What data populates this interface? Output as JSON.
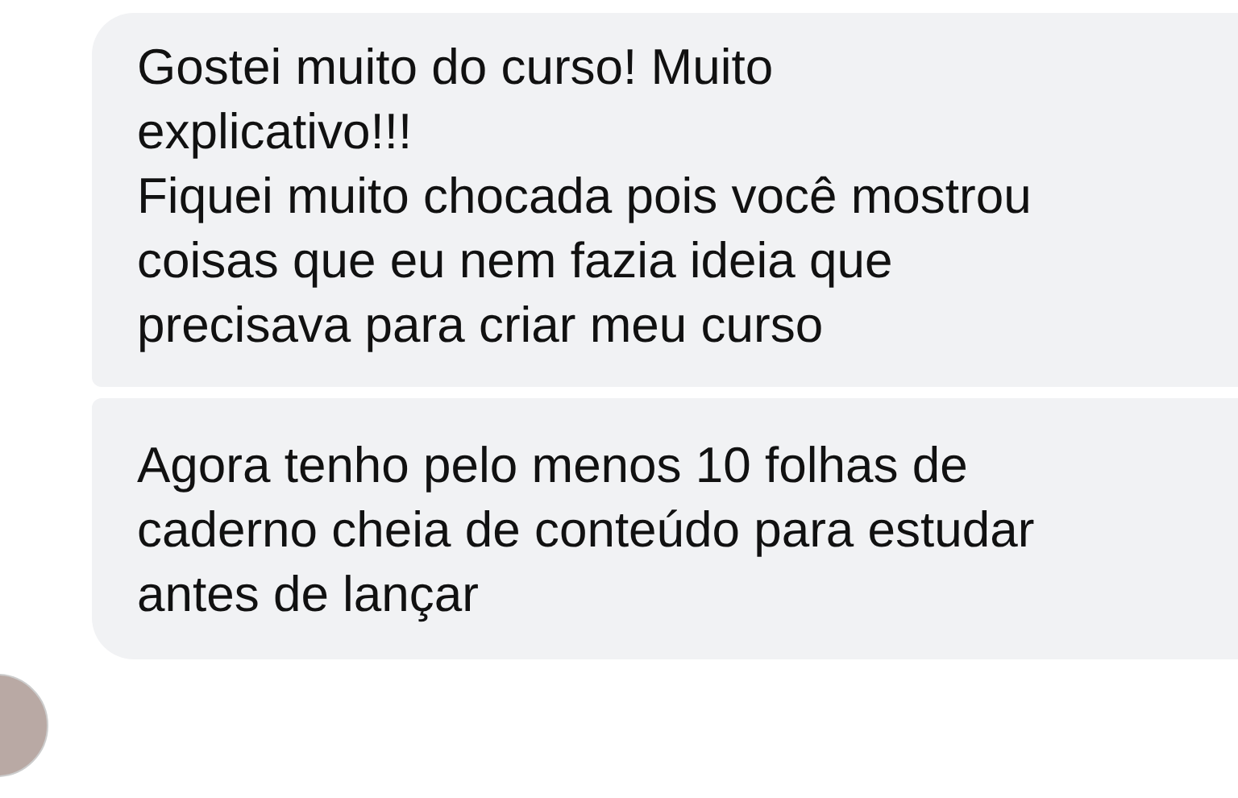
{
  "messages": [
    {
      "paragraphs": [
        [
          "Gostei muito do curso! Muito",
          "explicativo!!!"
        ],
        [
          "Fiquei muito chocada pois você mostrou",
          "coisas que eu nem fazia ideia que",
          "precisava para criar meu curso"
        ]
      ]
    },
    {
      "paragraphs": [
        [
          "Agora tenho pelo menos 10 folhas de",
          "caderno cheia de conteúdo para estudar",
          "antes de lançar"
        ]
      ]
    }
  ]
}
